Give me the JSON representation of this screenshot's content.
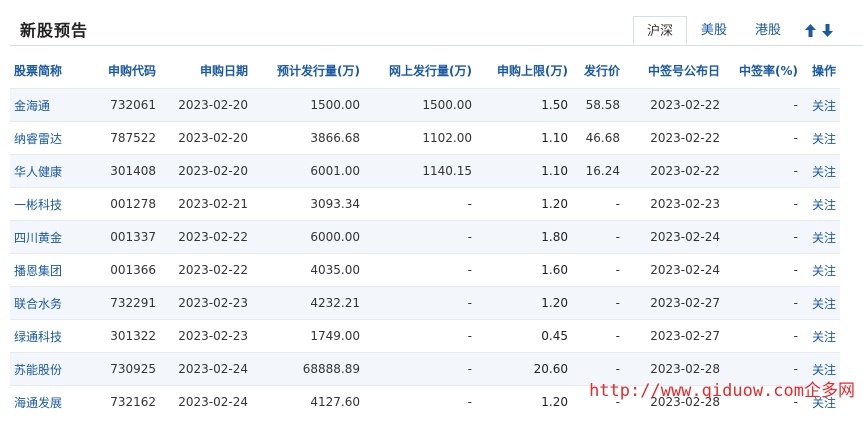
{
  "header": {
    "title": "新股预告",
    "tabs": [
      "沪深",
      "美股",
      "港股"
    ],
    "active_tab": 0
  },
  "table": {
    "columns": [
      "股票简称",
      "申购代码",
      "申购日期",
      "预计发行量(万)",
      "网上发行量(万)",
      "申购上限(万)",
      "发行价",
      "中签号公布日",
      "中签率(%)",
      "操作"
    ],
    "rows": [
      [
        "金海通",
        "732061",
        "2023-02-20",
        "1500.00",
        "1500.00",
        "1.50",
        "58.58",
        "2023-02-22",
        "-",
        "关注"
      ],
      [
        "纳睿雷达",
        "787522",
        "2023-02-20",
        "3866.68",
        "1102.00",
        "1.10",
        "46.68",
        "2023-02-22",
        "-",
        "关注"
      ],
      [
        "华人健康",
        "301408",
        "2023-02-20",
        "6001.00",
        "1140.15",
        "1.10",
        "16.24",
        "2023-02-22",
        "-",
        "关注"
      ],
      [
        "一彬科技",
        "001278",
        "2023-02-21",
        "3093.34",
        "-",
        "1.20",
        "-",
        "2023-02-23",
        "-",
        "关注"
      ],
      [
        "四川黄金",
        "001337",
        "2023-02-22",
        "6000.00",
        "-",
        "1.80",
        "-",
        "2023-02-24",
        "-",
        "关注"
      ],
      [
        "播恩集团",
        "001366",
        "2023-02-22",
        "4035.00",
        "-",
        "1.60",
        "-",
        "2023-02-24",
        "-",
        "关注"
      ],
      [
        "联合水务",
        "732291",
        "2023-02-23",
        "4232.21",
        "-",
        "1.20",
        "-",
        "2023-02-27",
        "-",
        "关注"
      ],
      [
        "绿通科技",
        "301322",
        "2023-02-23",
        "1749.00",
        "-",
        "0.45",
        "-",
        "2023-02-27",
        "-",
        "关注"
      ],
      [
        "苏能股份",
        "730925",
        "2023-02-24",
        "68888.89",
        "-",
        "20.60",
        "-",
        "2023-02-28",
        "-",
        "关注"
      ],
      [
        "海通发展",
        "732162",
        "2023-02-24",
        "4127.60",
        "-",
        "1.20",
        "-",
        "2023-02-28",
        "-",
        "关注"
      ]
    ]
  },
  "watermark": "http://www.qiduow.com企多网",
  "colors": {
    "link": "#1b5aa3",
    "stripe": "#f3f7fc",
    "watermark": "#e8282a"
  }
}
